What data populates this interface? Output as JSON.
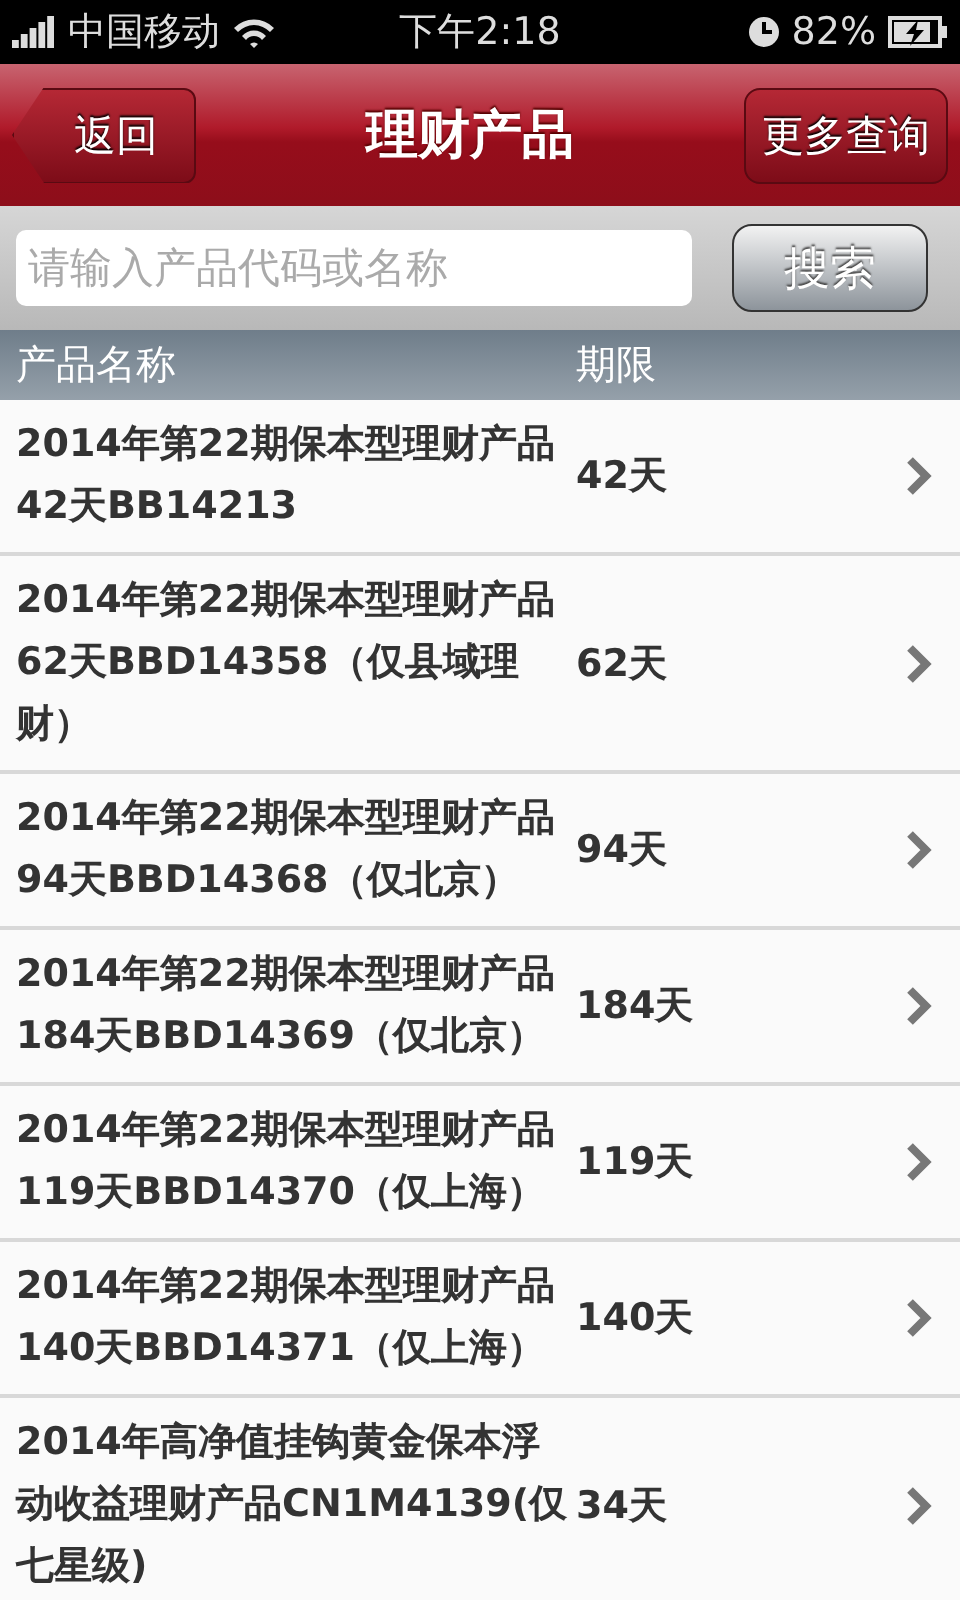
{
  "status_bar": {
    "carrier": "中国移动",
    "time": "下午2:18",
    "battery": "82%"
  },
  "nav_bar": {
    "back": "返回",
    "title": "理财产品",
    "action": "更多查询"
  },
  "search": {
    "placeholder": "请输入产品代码或名称",
    "button": "搜索"
  },
  "table": {
    "columns": [
      "产品名称",
      "期限"
    ],
    "rows": [
      {
        "name": "2014年第22期保本型理财产品42天BB14213",
        "term": "42天"
      },
      {
        "name": "2014年第22期保本型理财产品62天BBD14358（仅县域理财）",
        "term": "62天"
      },
      {
        "name": "2014年第22期保本型理财产品94天BBD14368（仅北京）",
        "term": "94天"
      },
      {
        "name": "2014年第22期保本型理财产品184天BBD14369（仅北京）",
        "term": "184天"
      },
      {
        "name": "2014年第22期保本型理财产品119天BBD14370（仅上海）",
        "term": "119天"
      },
      {
        "name": "2014年第22期保本型理财产品140天BBD14371（仅上海）",
        "term": "140天"
      },
      {
        "name": "2014年高净值挂钩黄金保本浮动收益理财产品CN1M4139(仅七星级)",
        "term": "34天"
      }
    ]
  }
}
